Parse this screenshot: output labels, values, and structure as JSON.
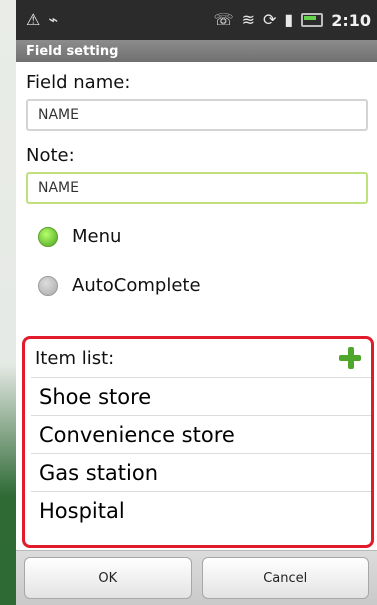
{
  "statusbar": {
    "time": "2:10",
    "icons": [
      "alert-icon",
      "usb-icon",
      "phone-icon",
      "wifi-icon",
      "sync-icon",
      "signal-icon",
      "battery-icon"
    ]
  },
  "titlebar": {
    "title": "Field setting"
  },
  "form": {
    "field_name_label": "Field name:",
    "field_name_value": "NAME",
    "note_label": "Note:",
    "note_value": "NAME"
  },
  "options": [
    {
      "label": "Menu",
      "selected": true
    },
    {
      "label": "AutoComplete",
      "selected": false
    }
  ],
  "item_list": {
    "label": "Item list:",
    "items": [
      "Shoe store",
      "Convenience store",
      "Gas station",
      "Hospital"
    ]
  },
  "buttons": {
    "ok": "OK",
    "cancel": "Cancel"
  }
}
